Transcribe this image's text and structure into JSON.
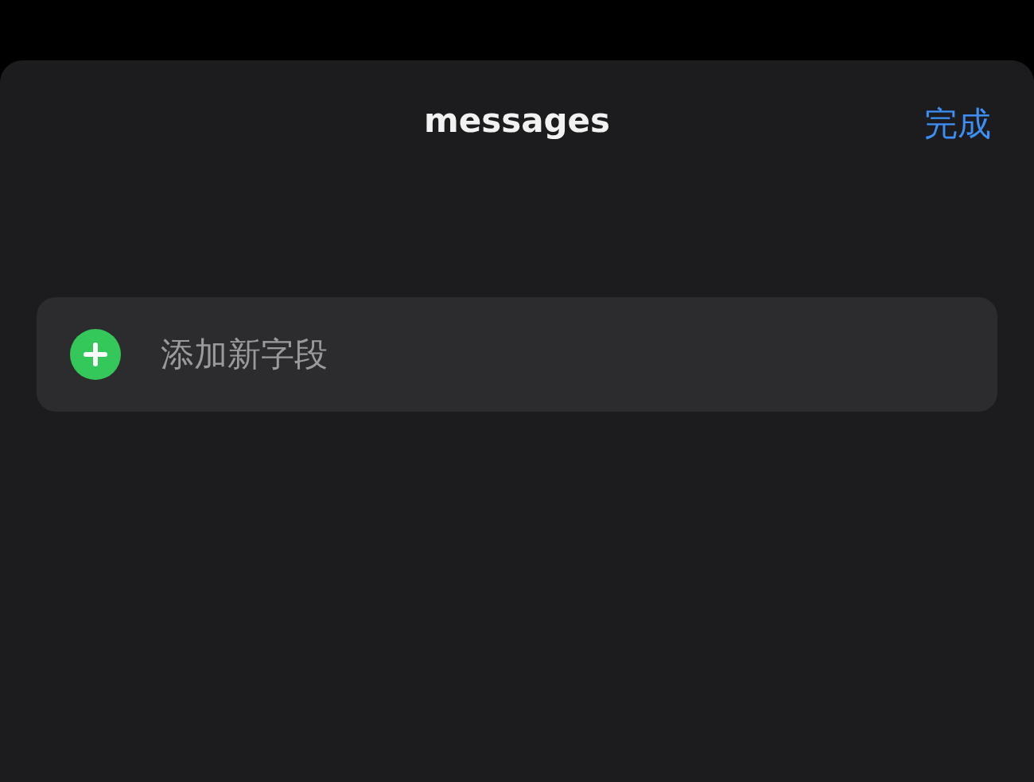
{
  "sheet": {
    "title": "messages",
    "done_button": "完成"
  },
  "rows": [
    {
      "kind": "add",
      "label": "添加新字段"
    }
  ]
}
